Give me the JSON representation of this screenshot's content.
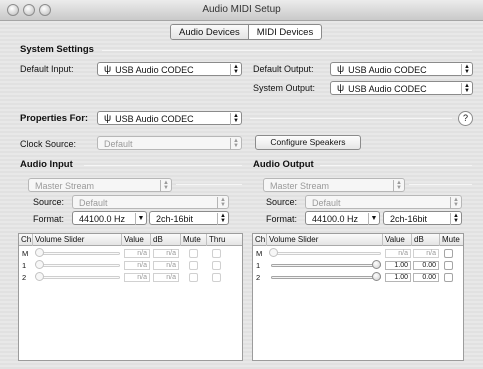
{
  "window": {
    "title": "Audio MIDI Setup"
  },
  "tabs": [
    {
      "label": "Audio Devices",
      "selected": true
    },
    {
      "label": "MIDI Devices",
      "selected": false
    }
  ],
  "system_settings": {
    "heading": "System Settings",
    "default_input_label": "Default Input:",
    "default_input_value": "USB Audio CODEC",
    "default_output_label": "Default Output:",
    "default_output_value": "USB Audio CODEC",
    "system_output_label": "System Output:",
    "system_output_value": "USB Audio CODEC"
  },
  "properties": {
    "label": "Properties For:",
    "value": "USB Audio CODEC",
    "help": "?"
  },
  "clock": {
    "label": "Clock Source:",
    "value": "Default",
    "configure_button": "Configure Speakers"
  },
  "audio_input": {
    "heading": "Audio Input",
    "stream": "Master Stream",
    "source_label": "Source:",
    "source_value": "Default",
    "format_label": "Format:",
    "format_rate": "44100.0 Hz",
    "format_channels": "2ch-16bit",
    "columns": [
      "Ch",
      "Volume Slider",
      "Value",
      "dB",
      "Mute",
      "Thru"
    ],
    "rows": [
      {
        "ch": "M",
        "value": "n/a",
        "db": "n/a",
        "level": 0
      },
      {
        "ch": "1",
        "value": "n/a",
        "db": "n/a",
        "level": 0
      },
      {
        "ch": "2",
        "value": "n/a",
        "db": "n/a",
        "level": 0
      }
    ]
  },
  "audio_output": {
    "heading": "Audio Output",
    "stream": "Master Stream",
    "source_label": "Source:",
    "source_value": "Default",
    "format_label": "Format:",
    "format_rate": "44100.0 Hz",
    "format_channels": "2ch-16bit",
    "columns": [
      "Ch",
      "Volume Slider",
      "Value",
      "dB",
      "Mute"
    ],
    "rows": [
      {
        "ch": "M",
        "value": "n/a",
        "db": "n/a",
        "level": 0
      },
      {
        "ch": "1",
        "value": "1.00",
        "db": "0.00",
        "level": 1
      },
      {
        "ch": "2",
        "value": "1.00",
        "db": "0.00",
        "level": 1
      }
    ]
  }
}
